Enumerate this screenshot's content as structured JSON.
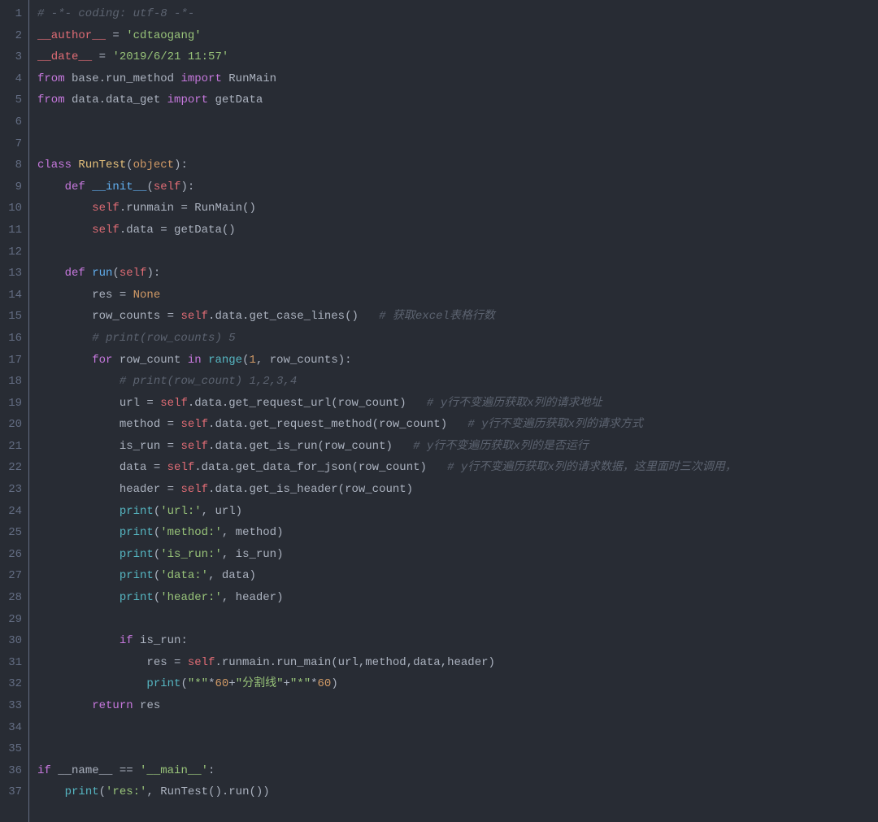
{
  "editor": {
    "lines": [
      {
        "num": "1",
        "tokens": [
          [
            "cm",
            "# -*- coding: utf-8 -*-"
          ]
        ]
      },
      {
        "num": "2",
        "tokens": [
          [
            "sf",
            "__author__"
          ],
          [
            "pn",
            " = "
          ],
          [
            "st",
            "'cdtaogang'"
          ]
        ]
      },
      {
        "num": "3",
        "tokens": [
          [
            "sf",
            "__date__"
          ],
          [
            "pn",
            " = "
          ],
          [
            "st",
            "'2019/6/21 11:57'"
          ]
        ]
      },
      {
        "num": "4",
        "tokens": [
          [
            "kw",
            "from"
          ],
          [
            "pn",
            " base.run_method "
          ],
          [
            "kw",
            "import"
          ],
          [
            "pn",
            " RunMain"
          ]
        ]
      },
      {
        "num": "5",
        "tokens": [
          [
            "kw",
            "from"
          ],
          [
            "pn",
            " data.data_get "
          ],
          [
            "kw",
            "import"
          ],
          [
            "pn",
            " getData"
          ]
        ]
      },
      {
        "num": "6",
        "tokens": []
      },
      {
        "num": "7",
        "tokens": []
      },
      {
        "num": "8",
        "tokens": [
          [
            "kw",
            "class "
          ],
          [
            "cl",
            "RunTest"
          ],
          [
            "pn",
            "("
          ],
          [
            "nm",
            "object"
          ],
          [
            "pn",
            "):"
          ]
        ]
      },
      {
        "num": "9",
        "tokens": [
          [
            "pn",
            "    "
          ],
          [
            "kw",
            "def "
          ],
          [
            "fn",
            "__init__"
          ],
          [
            "pn",
            "("
          ],
          [
            "sf",
            "self"
          ],
          [
            "pn",
            "):"
          ]
        ]
      },
      {
        "num": "10",
        "tokens": [
          [
            "pn",
            "        "
          ],
          [
            "sf",
            "self"
          ],
          [
            "pn",
            ".runmain = RunMain()"
          ]
        ]
      },
      {
        "num": "11",
        "tokens": [
          [
            "pn",
            "        "
          ],
          [
            "sf",
            "self"
          ],
          [
            "pn",
            ".data = getData()"
          ]
        ]
      },
      {
        "num": "12",
        "tokens": []
      },
      {
        "num": "13",
        "tokens": [
          [
            "pn",
            "    "
          ],
          [
            "kw",
            "def "
          ],
          [
            "fn",
            "run"
          ],
          [
            "pn",
            "("
          ],
          [
            "sf",
            "self"
          ],
          [
            "pn",
            "):"
          ]
        ]
      },
      {
        "num": "14",
        "tokens": [
          [
            "pn",
            "        res = "
          ],
          [
            "nm",
            "None"
          ]
        ]
      },
      {
        "num": "15",
        "tokens": [
          [
            "pn",
            "        row_counts = "
          ],
          [
            "sf",
            "self"
          ],
          [
            "pn",
            ".data.get_case_lines()   "
          ],
          [
            "cm",
            "# 获取excel表格行数"
          ]
        ]
      },
      {
        "num": "16",
        "tokens": [
          [
            "pn",
            "        "
          ],
          [
            "cm",
            "# print(row_counts) 5"
          ]
        ]
      },
      {
        "num": "17",
        "tokens": [
          [
            "pn",
            "        "
          ],
          [
            "kw",
            "for"
          ],
          [
            "pn",
            " row_count "
          ],
          [
            "kw",
            "in"
          ],
          [
            "pn",
            " "
          ],
          [
            "bi",
            "range"
          ],
          [
            "pn",
            "("
          ],
          [
            "nm",
            "1"
          ],
          [
            "pn",
            ", row_counts):"
          ]
        ]
      },
      {
        "num": "18",
        "tokens": [
          [
            "pn",
            "            "
          ],
          [
            "cm",
            "# print(row_count) 1,2,3,4"
          ]
        ]
      },
      {
        "num": "19",
        "tokens": [
          [
            "pn",
            "            url = "
          ],
          [
            "sf",
            "self"
          ],
          [
            "pn",
            ".data.get_request_url(row_count)   "
          ],
          [
            "cm",
            "# y行不变遍历获取x列的请求地址"
          ]
        ]
      },
      {
        "num": "20",
        "tokens": [
          [
            "pn",
            "            method = "
          ],
          [
            "sf",
            "self"
          ],
          [
            "pn",
            ".data.get_request_method(row_count)   "
          ],
          [
            "cm",
            "# y行不变遍历获取x列的请求方式"
          ]
        ]
      },
      {
        "num": "21",
        "tokens": [
          [
            "pn",
            "            is_run = "
          ],
          [
            "sf",
            "self"
          ],
          [
            "pn",
            ".data.get_is_run(row_count)   "
          ],
          [
            "cm",
            "# y行不变遍历获取x列的是否运行"
          ]
        ]
      },
      {
        "num": "22",
        "tokens": [
          [
            "pn",
            "            data = "
          ],
          [
            "sf",
            "self"
          ],
          [
            "pn",
            ".data.get_data_for_json(row_count)   "
          ],
          [
            "cm",
            "# y行不变遍历获取x列的请求数据，这里面时三次调用，"
          ]
        ]
      },
      {
        "num": "23",
        "tokens": [
          [
            "pn",
            "            header = "
          ],
          [
            "sf",
            "self"
          ],
          [
            "pn",
            ".data.get_is_header(row_count)"
          ]
        ]
      },
      {
        "num": "24",
        "tokens": [
          [
            "pn",
            "            "
          ],
          [
            "bi",
            "print"
          ],
          [
            "pn",
            "("
          ],
          [
            "st",
            "'url:'"
          ],
          [
            "pn",
            ", url)"
          ]
        ]
      },
      {
        "num": "25",
        "tokens": [
          [
            "pn",
            "            "
          ],
          [
            "bi",
            "print"
          ],
          [
            "pn",
            "("
          ],
          [
            "st",
            "'method:'"
          ],
          [
            "pn",
            ", method)"
          ]
        ]
      },
      {
        "num": "26",
        "tokens": [
          [
            "pn",
            "            "
          ],
          [
            "bi",
            "print"
          ],
          [
            "pn",
            "("
          ],
          [
            "st",
            "'is_run:'"
          ],
          [
            "pn",
            ", is_run)"
          ]
        ]
      },
      {
        "num": "27",
        "tokens": [
          [
            "pn",
            "            "
          ],
          [
            "bi",
            "print"
          ],
          [
            "pn",
            "("
          ],
          [
            "st",
            "'data:'"
          ],
          [
            "pn",
            ", data)"
          ]
        ]
      },
      {
        "num": "28",
        "tokens": [
          [
            "pn",
            "            "
          ],
          [
            "bi",
            "print"
          ],
          [
            "pn",
            "("
          ],
          [
            "st",
            "'header:'"
          ],
          [
            "pn",
            ", header)"
          ]
        ]
      },
      {
        "num": "29",
        "tokens": []
      },
      {
        "num": "30",
        "tokens": [
          [
            "pn",
            "            "
          ],
          [
            "kw",
            "if"
          ],
          [
            "pn",
            " is_run:"
          ]
        ]
      },
      {
        "num": "31",
        "tokens": [
          [
            "pn",
            "                res = "
          ],
          [
            "sf",
            "self"
          ],
          [
            "pn",
            ".runmain.run_main(url,method,data,header)"
          ]
        ]
      },
      {
        "num": "32",
        "tokens": [
          [
            "pn",
            "                "
          ],
          [
            "bi",
            "print"
          ],
          [
            "pn",
            "("
          ],
          [
            "st",
            "\"*\""
          ],
          [
            "pn",
            "*"
          ],
          [
            "nm",
            "60"
          ],
          [
            "pn",
            "+"
          ],
          [
            "st",
            "\"分割线\""
          ],
          [
            "pn",
            "+"
          ],
          [
            "st",
            "\"*\""
          ],
          [
            "pn",
            "*"
          ],
          [
            "nm",
            "60"
          ],
          [
            "pn",
            ")"
          ]
        ]
      },
      {
        "num": "33",
        "tokens": [
          [
            "pn",
            "        "
          ],
          [
            "kw",
            "return"
          ],
          [
            "pn",
            " res"
          ]
        ]
      },
      {
        "num": "34",
        "tokens": []
      },
      {
        "num": "35",
        "tokens": []
      },
      {
        "num": "36",
        "tokens": [
          [
            "kw",
            "if"
          ],
          [
            "pn",
            " __name__ == "
          ],
          [
            "st",
            "'__main__'"
          ],
          [
            "pn",
            ":"
          ]
        ]
      },
      {
        "num": "37",
        "tokens": [
          [
            "pn",
            "    "
          ],
          [
            "bi",
            "print"
          ],
          [
            "pn",
            "("
          ],
          [
            "st",
            "'res:'"
          ],
          [
            "pn",
            ", RunTest().run())"
          ]
        ]
      }
    ]
  }
}
